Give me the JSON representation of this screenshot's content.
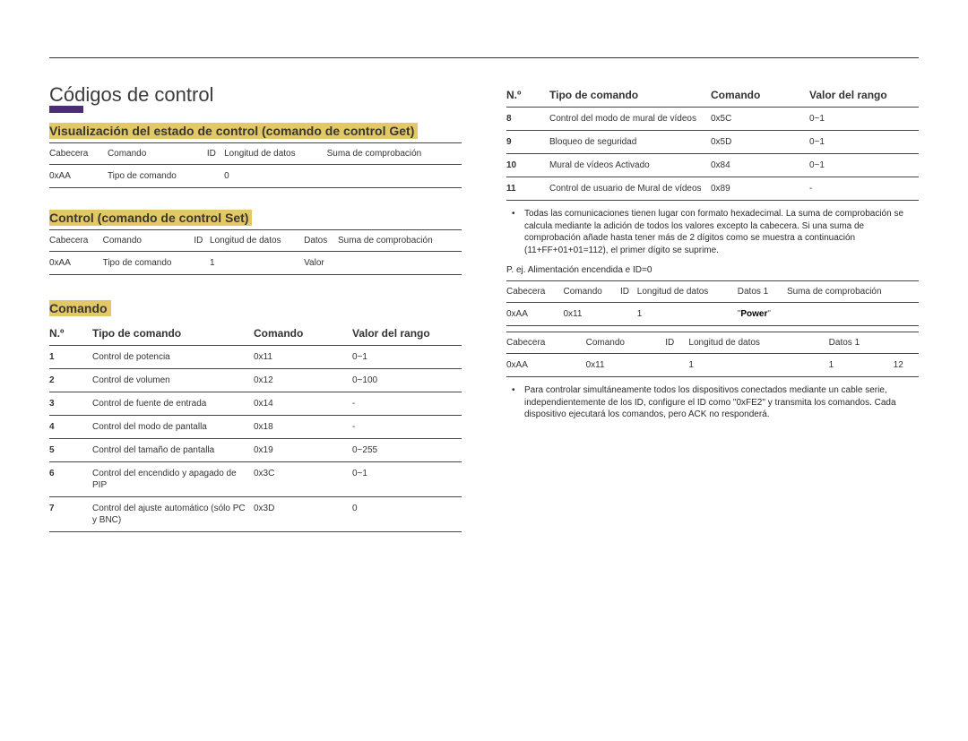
{
  "page": {
    "title": "Códigos de control"
  },
  "sections": {
    "get": {
      "heading": "Visualización del estado de control (comando de control Get)",
      "headers": [
        "Cabecera",
        "Comando",
        "ID",
        "Longitud de datos",
        "Suma de comprobación"
      ],
      "row": [
        "0xAA",
        "Tipo de comando",
        "",
        "0",
        ""
      ]
    },
    "set": {
      "heading": "Control (comando de control Set)",
      "headers": [
        "Cabecera",
        "Comando",
        "ID",
        "Longitud de datos",
        "Datos",
        "Suma de comprobación"
      ],
      "row": [
        "0xAA",
        "Tipo de comando",
        "",
        "1",
        "Valor",
        ""
      ]
    },
    "comando": {
      "heading": "Comando",
      "headers": [
        "N.º",
        "Tipo de comando",
        "Comando",
        "Valor del rango"
      ],
      "rows_left": [
        [
          "1",
          "Control de potencia",
          "0x11",
          "0~1"
        ],
        [
          "2",
          "Control de volumen",
          "0x12",
          "0~100"
        ],
        [
          "3",
          "Control de fuente de entrada",
          "0x14",
          "-"
        ],
        [
          "4",
          "Control del modo de pantalla",
          "0x18",
          "-"
        ],
        [
          "5",
          "Control del tamaño de pantalla",
          "0x19",
          "0~255"
        ],
        [
          "6",
          "Control del encendido y apagado de PIP",
          "0x3C",
          "0~1"
        ],
        [
          "7",
          "Control del ajuste automático (sólo PC y BNC)",
          "0x3D",
          "0"
        ]
      ],
      "rows_right": [
        [
          "8",
          "Control del modo de mural de vídeos",
          "0x5C",
          "0~1"
        ],
        [
          "9",
          "Bloqueo de seguridad",
          "0x5D",
          "0~1"
        ],
        [
          "10",
          "Mural de vídeos Activado",
          "0x84",
          "0~1"
        ],
        [
          "11",
          "Control de usuario de Mural de vídeos",
          "0x89",
          "-"
        ]
      ]
    },
    "notes": {
      "n1": "Todas las comunicaciones tienen lugar con formato hexadecimal. La suma de comprobación se calcula mediante la adición de todos los valores excepto la cabecera. Si una suma de comprobación añade hasta tener más de 2 dígitos como se muestra a continuación (11+FF+01+01=112), el primer dígito se suprime.",
      "example_label": "P. ej. Alimentación encendida e ID=0",
      "ex1": {
        "headers": [
          "Cabecera",
          "Comando",
          "ID",
          "Longitud de datos",
          "Datos 1",
          "Suma de comprobación"
        ],
        "row": [
          "0xAA",
          "0x11",
          "",
          "1",
          "\"Power\"",
          ""
        ]
      },
      "ex2": {
        "headers": [
          "Cabecera",
          "Comando",
          "ID",
          "Longitud de datos",
          "Datos 1",
          ""
        ],
        "row": [
          "0xAA",
          "0x11",
          "",
          "1",
          "1",
          "12"
        ]
      },
      "n2": "Para controlar simultáneamente todos los dispositivos conectados mediante un cable serie, independientemente de los ID, configure el ID como \"0xFE2\" y transmita los comandos. Cada dispositivo ejecutará los comandos, pero ACK no responderá."
    }
  }
}
